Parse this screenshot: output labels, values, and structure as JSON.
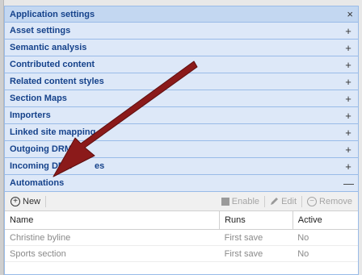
{
  "panel": {
    "title": "Application settings",
    "close_symbol": "×"
  },
  "accordion": [
    {
      "label": "Asset settings",
      "tool": "+"
    },
    {
      "label": "Semantic analysis",
      "tool": "+"
    },
    {
      "label": "Contributed content",
      "tool": "+"
    },
    {
      "label": "Related content styles",
      "tool": "+"
    },
    {
      "label": "Section Maps",
      "tool": "+"
    },
    {
      "label": "Importers",
      "tool": "+"
    },
    {
      "label": "Linked site mapping",
      "tool": "+"
    },
    {
      "label": "Outgoing DRM",
      "tool": "+"
    },
    {
      "label": "Incoming DRM",
      "label_tail": "es",
      "tool": "+"
    },
    {
      "label": "Automations",
      "tool": "—"
    }
  ],
  "toolbar": {
    "new_label": "New",
    "enable_label": "Enable",
    "edit_label": "Edit",
    "remove_label": "Remove"
  },
  "grid": {
    "columns": [
      "Name",
      "Runs",
      "Active"
    ],
    "rows": [
      [
        "Christine byline",
        "First save",
        "No"
      ],
      [
        "Sports section",
        "First save",
        "No"
      ]
    ]
  },
  "colors": {
    "annotation_arrow": "#8b1a1a",
    "header_bg": "#c3d7f1",
    "accordion_bg": "#dde8f8"
  }
}
